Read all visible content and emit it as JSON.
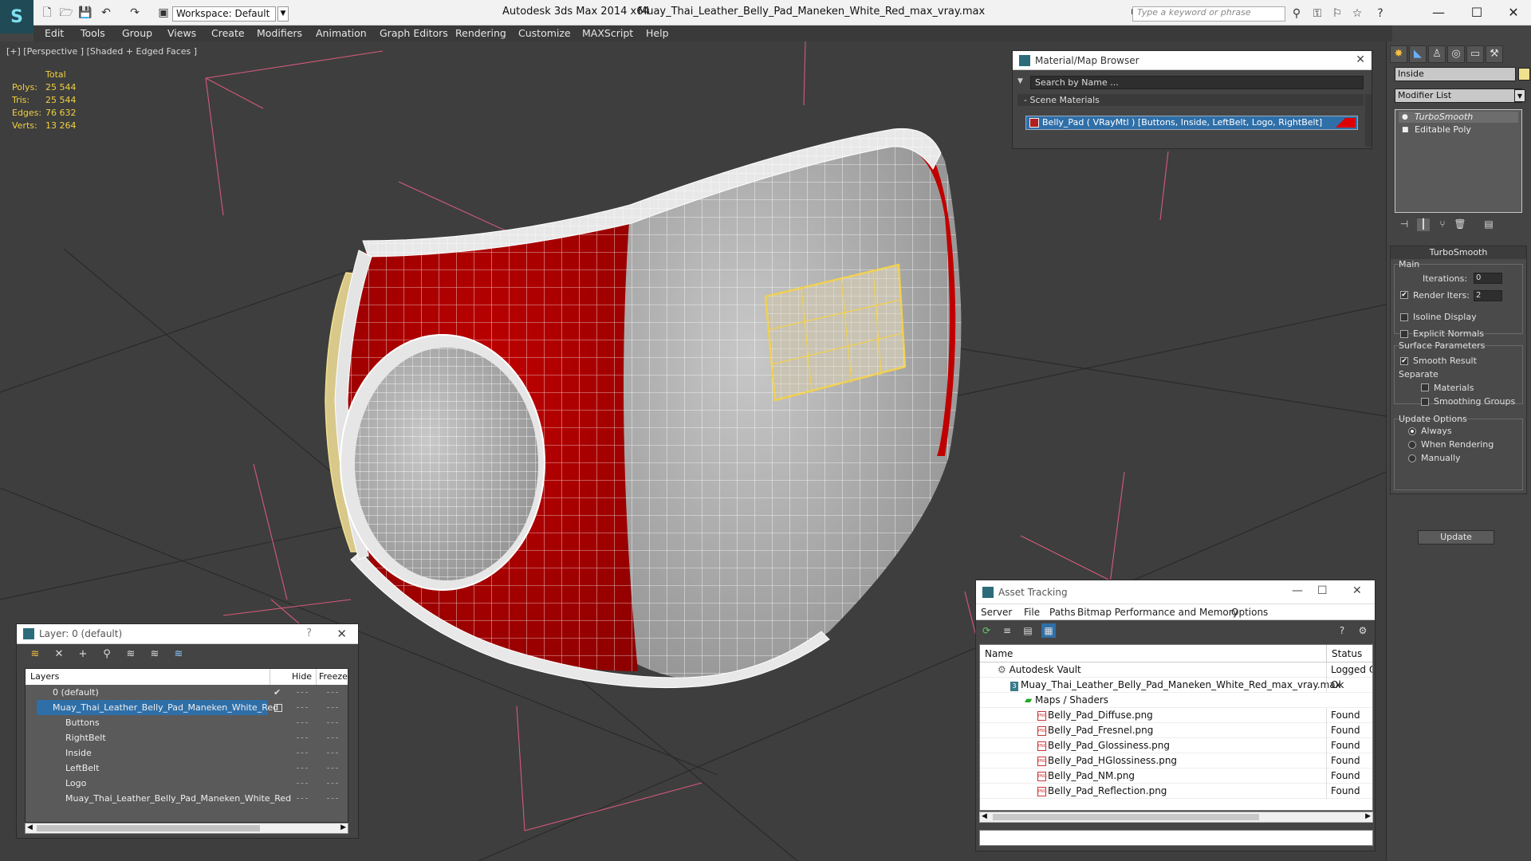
{
  "titlebar": {
    "app_title": "Autodesk 3ds Max  2014 x64",
    "doc_title": "Muay_Thai_Leather_Belly_Pad_Maneken_White_Red_max_vray.max",
    "workspace_label": "Workspace: Default",
    "search_placeholder": "Type a keyword or phrase"
  },
  "menubar": {
    "items": [
      "Edit",
      "Tools",
      "Group",
      "Views",
      "Create",
      "Modifiers",
      "Animation",
      "Graph Editors",
      "Rendering",
      "Customize",
      "MAXScript",
      "Help"
    ]
  },
  "viewport": {
    "label": "[+] [Perspective ] [Shaded + Edged Faces ]",
    "stats": {
      "header": "Total",
      "rows": [
        {
          "label": "Polys:",
          "value": "25 544"
        },
        {
          "label": "Tris:",
          "value": "25 544"
        },
        {
          "label": "Edges:",
          "value": "76 632"
        },
        {
          "label": "Verts:",
          "value": "13 264"
        }
      ]
    }
  },
  "command_panel": {
    "object_name": "Inside",
    "object_color": "#f0e18c",
    "modifier_list_label": "Modifier List",
    "stack": [
      "TurboSmooth",
      "Editable Poly"
    ],
    "rollout": {
      "title": "TurboSmooth",
      "main_label": "Main",
      "iterations_label": "Iterations:",
      "iterations_value": "0",
      "render_iters_label": "Render Iters:",
      "render_iters_value": "2",
      "isoline_label": "Isoline Display",
      "explicit_normals_label": "Explicit Normals",
      "surface_params_label": "Surface Parameters",
      "smooth_result_label": "Smooth Result",
      "separate_label": "Separate",
      "materials_label": "Materials",
      "smoothing_groups_label": "Smoothing Groups",
      "update_options_label": "Update Options",
      "always_label": "Always",
      "when_rendering_label": "When Rendering",
      "manually_label": "Manually",
      "update_button": "Update"
    }
  },
  "material_browser": {
    "title": "Material/Map Browser",
    "search_placeholder": "Search by Name ...",
    "section": "- Scene Materials",
    "material": "Belly_Pad  ( VRayMtl ) [Buttons, Inside, LeftBelt, Logo, RightBelt]"
  },
  "layer_dialog": {
    "title": "Layer: 0 (default)",
    "help": "?",
    "columns": {
      "layers": "Layers",
      "hide": "Hide",
      "freeze": "Freeze"
    },
    "rows": [
      {
        "name": "0 (default)",
        "indent": 0
      },
      {
        "name": "Muay_Thai_Leather_Belly_Pad_Maneken_White_Red",
        "indent": 0
      },
      {
        "name": "Buttons",
        "indent": 1
      },
      {
        "name": "RightBelt",
        "indent": 1
      },
      {
        "name": "Inside",
        "indent": 1
      },
      {
        "name": "LeftBelt",
        "indent": 1
      },
      {
        "name": "Logo",
        "indent": 1
      },
      {
        "name": "Muay_Thai_Leather_Belly_Pad_Maneken_White_Red",
        "indent": 1
      }
    ]
  },
  "asset_tracking": {
    "title": "Asset Tracking",
    "menu": [
      "Server",
      "File",
      "Paths",
      "Bitmap Performance and Memory",
      "Options"
    ],
    "columns": {
      "name": "Name",
      "status": "Status"
    },
    "rows": [
      {
        "name": "Autodesk Vault",
        "status": "Logged Ou"
      },
      {
        "name": "Muay_Thai_Leather_Belly_Pad_Maneken_White_Red_max_vray.max",
        "status": "Ok"
      },
      {
        "name": "Maps / Shaders",
        "status": ""
      },
      {
        "name": "Belly_Pad_Diffuse.png",
        "status": "Found"
      },
      {
        "name": "Belly_Pad_Fresnel.png",
        "status": "Found"
      },
      {
        "name": "Belly_Pad_Glossiness.png",
        "status": "Found"
      },
      {
        "name": "Belly_Pad_HGlossiness.png",
        "status": "Found"
      },
      {
        "name": "Belly_Pad_NM.png",
        "status": "Found"
      },
      {
        "name": "Belly_Pad_Reflection.png",
        "status": "Found"
      }
    ]
  }
}
